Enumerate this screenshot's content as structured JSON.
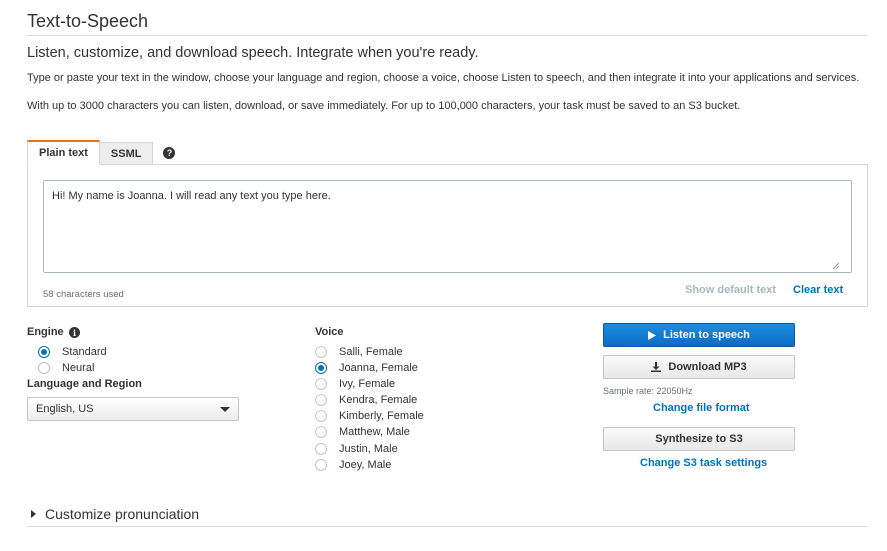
{
  "header": {
    "title": "Text-to-Speech",
    "subtitle": "Listen, customize, and download speech. Integrate when you're ready.",
    "description_1": "Type or paste your text in the window, choose your language and region, choose a voice, choose Listen to speech, and then integrate it into your applications and services.",
    "description_2": "With up to 3000 characters you can listen, download, or save immediately. For up to 100,000 characters, your task must be saved to an S3 bucket."
  },
  "tabs": [
    {
      "label": "Plain text",
      "active": true
    },
    {
      "label": "SSML",
      "active": false
    }
  ],
  "help_icon": "question-circle-icon",
  "editor": {
    "text": "Hi! My name is Joanna. I will read any text you type here.",
    "char_count": "58 characters used",
    "show_default_label": "Show default text",
    "clear_label": "Clear text"
  },
  "engine": {
    "label": "Engine",
    "info_icon": "info-icon",
    "options": [
      {
        "label": "Standard",
        "checked": true
      },
      {
        "label": "Neural",
        "checked": false
      }
    ]
  },
  "language": {
    "label": "Language and Region",
    "selected": "English, US"
  },
  "voice": {
    "label": "Voice",
    "options": [
      {
        "label": "Salli, Female",
        "checked": false
      },
      {
        "label": "Joanna, Female",
        "checked": true
      },
      {
        "label": "Ivy, Female",
        "checked": false
      },
      {
        "label": "Kendra, Female",
        "checked": false
      },
      {
        "label": "Kimberly, Female",
        "checked": false
      },
      {
        "label": "Matthew, Male",
        "checked": false
      },
      {
        "label": "Justin, Male",
        "checked": false
      },
      {
        "label": "Joey, Male",
        "checked": false
      }
    ]
  },
  "actions": {
    "listen_label": "Listen to speech",
    "download_label": "Download MP3",
    "sample_rate": "Sample rate: 22050Hz",
    "change_format_label": "Change file format",
    "synthesize_label": "Synthesize to S3",
    "change_s3_label": "Change S3 task settings"
  },
  "colors": {
    "accent_tab": "#ec7211",
    "primary_button": "#1a7fd4",
    "link": "#0073bb"
  },
  "customize": {
    "label": "Customize pronunciation"
  }
}
